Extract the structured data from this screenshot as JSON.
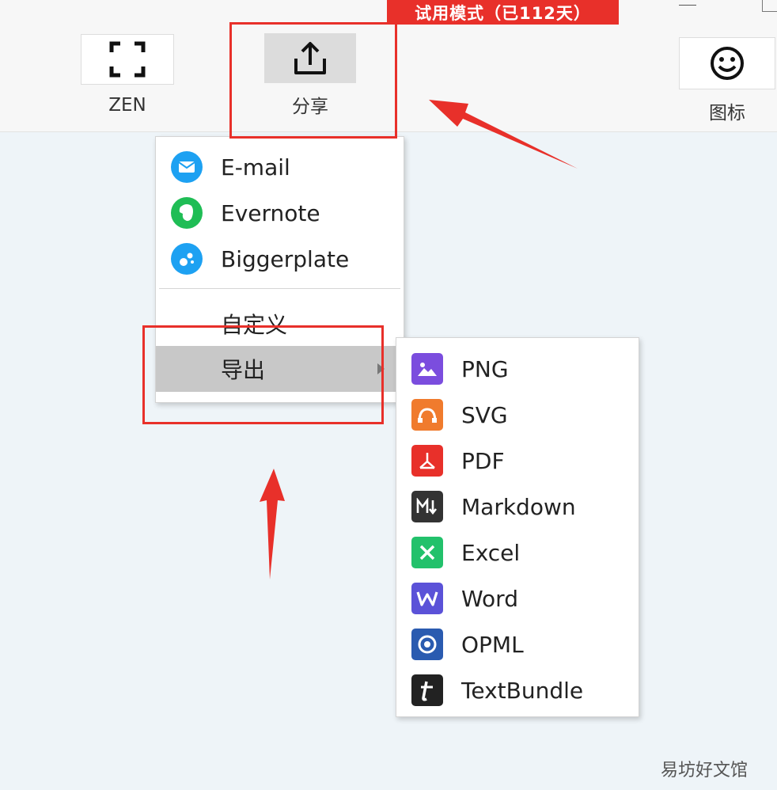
{
  "trial_badge": "试用模式（已112天）",
  "toolbar": {
    "zen_label": "ZEN",
    "share_label": "分享",
    "icon_label": "图标"
  },
  "share_menu": {
    "items": [
      {
        "label": "E-mail",
        "icon": "mail-icon",
        "color": "#1da1f2"
      },
      {
        "label": "Evernote",
        "icon": "evernote-icon",
        "color": "#1fbd55"
      },
      {
        "label": "Biggerplate",
        "icon": "biggerplate-icon",
        "color": "#1da1f2"
      }
    ],
    "custom_label": "自定义",
    "export_label": "导出"
  },
  "export_menu": {
    "items": [
      {
        "label": "PNG",
        "icon": "image-icon",
        "color": "#7b4dde"
      },
      {
        "label": "SVG",
        "icon": "svg-icon",
        "color": "#f07b2d"
      },
      {
        "label": "PDF",
        "icon": "pdf-icon",
        "color": "#e8302a"
      },
      {
        "label": "Markdown",
        "icon": "markdown-icon",
        "color": "#333333"
      },
      {
        "label": "Excel",
        "icon": "excel-icon",
        "color": "#22c16b"
      },
      {
        "label": "Word",
        "icon": "word-icon",
        "color": "#5b52d8"
      },
      {
        "label": "OPML",
        "icon": "opml-icon",
        "color": "#2a5bb0"
      },
      {
        "label": "TextBundle",
        "icon": "textbundle-icon",
        "color": "#222222"
      }
    ]
  },
  "watermark": "易坊好文馆",
  "colors": {
    "highlight": "#e8302a",
    "accent_red": "#e8302a"
  }
}
